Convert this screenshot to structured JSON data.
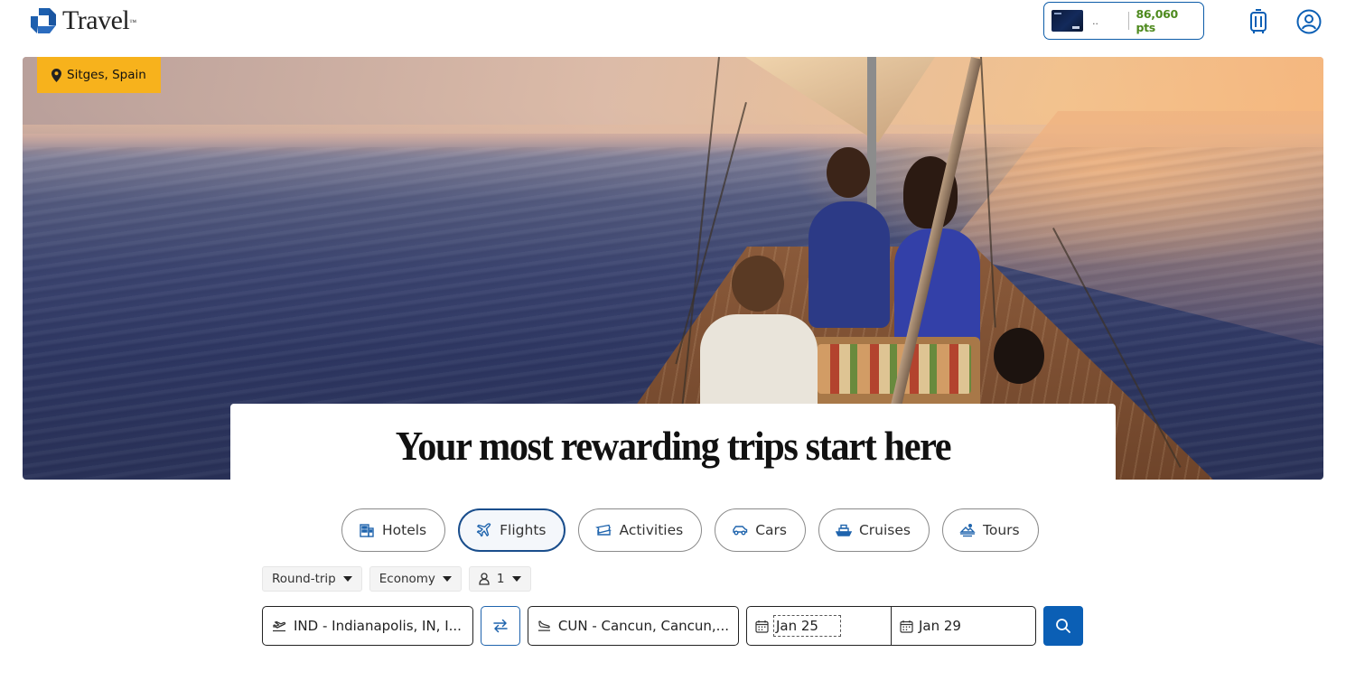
{
  "header": {
    "brand_name": "Travel",
    "brand_tm": "™",
    "card_masked": "..",
    "points": "86,060 pts",
    "icons": [
      "luggage-icon",
      "account-icon"
    ]
  },
  "hero": {
    "location": "Sitges, Spain",
    "headline": "Your most rewarding trips start here"
  },
  "tabs": [
    {
      "label": "Hotels",
      "icon": "hotel-icon",
      "active": false
    },
    {
      "label": "Flights",
      "icon": "airplane-icon",
      "active": true
    },
    {
      "label": "Activities",
      "icon": "ticket-icon",
      "active": false
    },
    {
      "label": "Cars",
      "icon": "car-icon",
      "active": false
    },
    {
      "label": "Cruises",
      "icon": "ship-icon",
      "active": false
    },
    {
      "label": "Tours",
      "icon": "tour-icon",
      "active": false
    }
  ],
  "options": {
    "trip_type": "Round-trip",
    "cabin_class": "Economy",
    "travelers": "1"
  },
  "search": {
    "origin": "IND - Indianapolis, IN, I...",
    "destination": "CUN - Cancun, Cancun,...",
    "depart_date": "Jan 25",
    "return_date": "Jan 29"
  },
  "colors": {
    "brand_blue": "#0b5fb5",
    "points_green": "#4e8a1e",
    "location_tag": "#f7b21c",
    "active_tab_border": "#1a4e8c"
  }
}
